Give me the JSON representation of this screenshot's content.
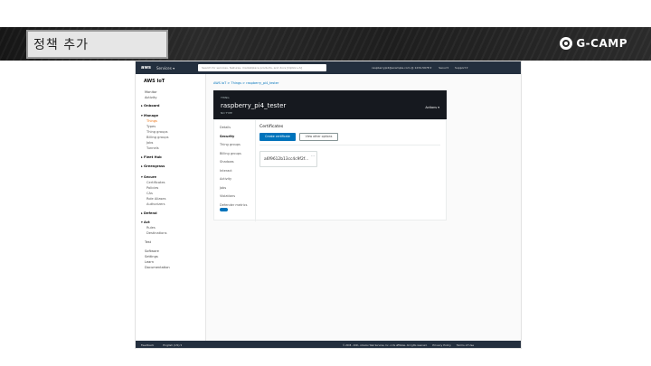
{
  "slide": {
    "title": "정책 추가",
    "brand": "G-CAMP"
  },
  "console": {
    "nav": {
      "logo": "aws",
      "services": "Services ▾",
      "search_placeholder": "Search for services, features, marketplace products, and docs",
      "search_shortcut": "[Option+S]",
      "account": "raspberrypi4@example.com @ 1234-5678 ▾",
      "region": "Seoul ▾",
      "support": "Support ▾"
    },
    "sidebar": {
      "title": "AWS IoT",
      "items": [
        {
          "label": "Monitor",
          "type": "item"
        },
        {
          "label": "Activity",
          "type": "item"
        },
        {
          "label": "▸ Onboard",
          "type": "head"
        },
        {
          "label": "▾ Manage",
          "type": "head"
        },
        {
          "label": "Things",
          "type": "sub",
          "active": true
        },
        {
          "label": "Types",
          "type": "sub"
        },
        {
          "label": "Thing groups",
          "type": "sub"
        },
        {
          "label": "Billing groups",
          "type": "sub"
        },
        {
          "label": "Jobs",
          "type": "sub"
        },
        {
          "label": "Tunnels",
          "type": "sub"
        },
        {
          "label": "▸ Fleet Hub",
          "type": "head"
        },
        {
          "label": "▸ Greengrass",
          "type": "head"
        },
        {
          "label": "▾ Secure",
          "type": "head"
        },
        {
          "label": "Certificates",
          "type": "sub"
        },
        {
          "label": "Policies",
          "type": "sub"
        },
        {
          "label": "CAs",
          "type": "sub"
        },
        {
          "label": "Role Aliases",
          "type": "sub"
        },
        {
          "label": "Authorizers",
          "type": "sub"
        },
        {
          "label": "▸ Defend",
          "type": "head"
        },
        {
          "label": "▾ Act",
          "type": "head"
        },
        {
          "label": "Rules",
          "type": "sub"
        },
        {
          "label": "Destinations",
          "type": "sub"
        },
        {
          "label": "Test",
          "type": "item"
        },
        {
          "label": "Software",
          "type": "item"
        },
        {
          "label": "Settings",
          "type": "item"
        },
        {
          "label": "Learn",
          "type": "item"
        },
        {
          "label": "Documentation",
          "type": "item"
        }
      ]
    },
    "breadcrumb": "AWS IoT  >  Things  >  raspberry_pi4_tester",
    "thing": {
      "label": "THING",
      "name": "raspberry_pi4_tester",
      "arn": "NO TYPE",
      "actions": "Actions ▾"
    },
    "tabs": [
      {
        "label": "Details"
      },
      {
        "label": "Security",
        "active": true
      },
      {
        "label": "Thing groups"
      },
      {
        "label": "Billing groups"
      },
      {
        "label": "Shadows"
      },
      {
        "label": "Interact"
      },
      {
        "label": "Activity"
      },
      {
        "label": "Jobs"
      },
      {
        "label": "Violations"
      },
      {
        "label": "Defender metrics"
      }
    ],
    "pane": {
      "title": "Certificates",
      "create_button": "Create certificate",
      "view_button": "View other options",
      "certificate_id": "a6f9612b13cc4c9f2f...",
      "more_icon": "…"
    },
    "footer": {
      "feedback": "Feedback",
      "language": "English (US) ▾",
      "copyright": "© 2008 - 2021, Amazon Web Services, Inc. or its affiliates. All rights reserved.",
      "privacy": "Privacy Policy",
      "terms": "Terms of Use"
    }
  }
}
